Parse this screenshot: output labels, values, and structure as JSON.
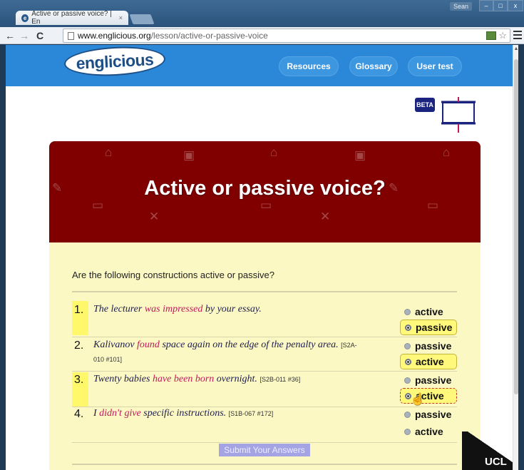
{
  "browser": {
    "tab_title": "Active or passive voice? | En",
    "tab_close": "×",
    "user": "Sean",
    "window_buttons": [
      "–",
      "□",
      "x"
    ],
    "url_host": "www.englicious.org",
    "url_path": "/lesson/active-or-passive-voice"
  },
  "site": {
    "logo_text": "englicious",
    "nav": [
      "Resources",
      "Glossary",
      "User test"
    ],
    "beta_badge": "BETA"
  },
  "lesson": {
    "title": "Active or passive voice?",
    "prompt": "Are the following constructions active or passive?",
    "questions": [
      {
        "num": "1.",
        "pre": "The lecturer ",
        "verb": "was impressed",
        "post": " by your essay.",
        "ref": "",
        "options": [
          "active",
          "passive"
        ],
        "selected": "passive"
      },
      {
        "num": "2.",
        "pre": "Kalivanov ",
        "verb": "found",
        "post": " space again on the edge of the penalty area. ",
        "ref": "[S2A-010 #101]",
        "options": [
          "passive",
          "active"
        ],
        "selected": "active"
      },
      {
        "num": "3.",
        "pre": "Twenty babies ",
        "verb": "have been born",
        "post": " overnight. ",
        "ref": "[S2B-011 #36]",
        "options": [
          "passive",
          "active"
        ],
        "selected": "active"
      },
      {
        "num": "4.",
        "pre": "I ",
        "verb": "didn't give",
        "post": " specific instructions. ",
        "ref": "[S1B-067 #172]",
        "options": [
          "passive",
          "active"
        ],
        "selected": null
      }
    ],
    "submit_label": "Submit Your Answers"
  },
  "footer": {
    "ucl_logo": "UCL"
  },
  "colors": {
    "nav_blue": "#2b88d8",
    "hero_maroon": "#800000",
    "panel_yellow": "#fbf8c4",
    "highlight": "#fff86a"
  }
}
